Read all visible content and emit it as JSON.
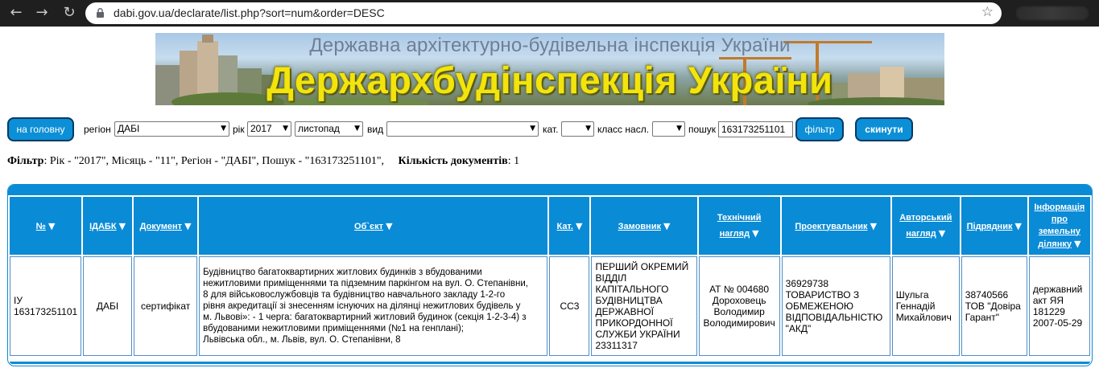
{
  "browser": {
    "url": "dabi.gov.ua/declarate/list.php?sort=num&order=DESC"
  },
  "banner": {
    "subtitle": "Державна архітектурно-будівельна інспекція України",
    "title": "Держархбудінспекція України"
  },
  "controls": {
    "home_button": "на головну",
    "region_label": "регіон",
    "region_value": "ДАБІ",
    "year_label": "рік",
    "year_value": "2017",
    "month_value": "листопад",
    "type_label": "вид",
    "type_value": "",
    "category_label": "кат.",
    "category_value": "",
    "class_label": "класс насл.",
    "class_value": "",
    "search_label": "пошук",
    "search_value": "163173251101",
    "filter_button": "фільтр",
    "reset_button": "скинути"
  },
  "filter_summary": {
    "filter_label": "Фільтр",
    "filter_text": ": Рік - \"2017\", Місяць - \"11\", Регіон - \"ДАБІ\", Пошук - \"163173251101\",",
    "count_label": "Кількість документів",
    "count_value": ": 1"
  },
  "table": {
    "headers": {
      "num": "№",
      "idabk": "ІДАБК",
      "document": "Документ",
      "object": "Об`єкт",
      "cat": "Кат.",
      "customer": "Замовник",
      "tech_l1": "Технічний",
      "tech_l2": "нагляд",
      "designer": "Проектувальник",
      "author_l1": "Авторський",
      "author_l2": "нагляд",
      "contractor": "Підрядник",
      "land_l1": "Інформація",
      "land_l2": "про",
      "land_l3": "земельну",
      "land_l4": "ділянку"
    },
    "row": {
      "num_l1": "ІУ",
      "num_l2": "163173251101",
      "idabk": "ДАБІ",
      "document": "сертифікат",
      "object_l1": "Будівництво багатоквартирних житлових будинків з вбудованими",
      "object_l2": "нежитловими приміщеннями та підземним паркінгом на вул. О. Степанівни,",
      "object_l3": "8 для військовослужбовців та будівництво навчального закладу 1-2-го",
      "object_l4": "рівня акредитації зі знесенням існуючих на ділянці нежитлових будівель у",
      "object_l5": "м. Львові»: - 1 черга: багатоквартирний житловий будинок (секція 1-2-3-4) з",
      "object_l6": "вбудованими нежитловими приміщеннями (№1 на генплані);",
      "object_l7": "Львівська обл., м. Львів, вул. О. Степанівни, 8",
      "cat": "СС3",
      "customer_l1": "ПЕРШИЙ ОКРЕМИЙ",
      "customer_l2": "ВІДДІЛ",
      "customer_l3": "КАПІТАЛЬНОГО",
      "customer_l4": "БУДІВНИЦТВА",
      "customer_l5": "ДЕРЖАВНОЇ",
      "customer_l6": "ПРИКОРДОННОЇ",
      "customer_l7": "СЛУЖБИ УКРАЇНИ",
      "customer_l8": "23311317",
      "tech_l1": "АТ № 004680",
      "tech_l2": "Дороховець",
      "tech_l3": "Володимир",
      "tech_l4": "Володимирович",
      "designer_l1": "36929738",
      "designer_l2": "ТОВАРИСТВО З",
      "designer_l3": "ОБМЕЖЕНОЮ",
      "designer_l4": "ВІДПОВІДАЛЬНІСТЮ",
      "designer_l5": "\"АКД\"",
      "author_l1": "Шульга",
      "author_l2": "Геннадій",
      "author_l3": "Михайлович",
      "contractor_l1": "38740566",
      "contractor_l2": "ТОВ \"Довіра",
      "contractor_l3": "Гарант\"",
      "land_l1": "державний",
      "land_l2": "акт ЯЯ",
      "land_l3": "181229",
      "land_l4": "2007-05-29"
    }
  }
}
